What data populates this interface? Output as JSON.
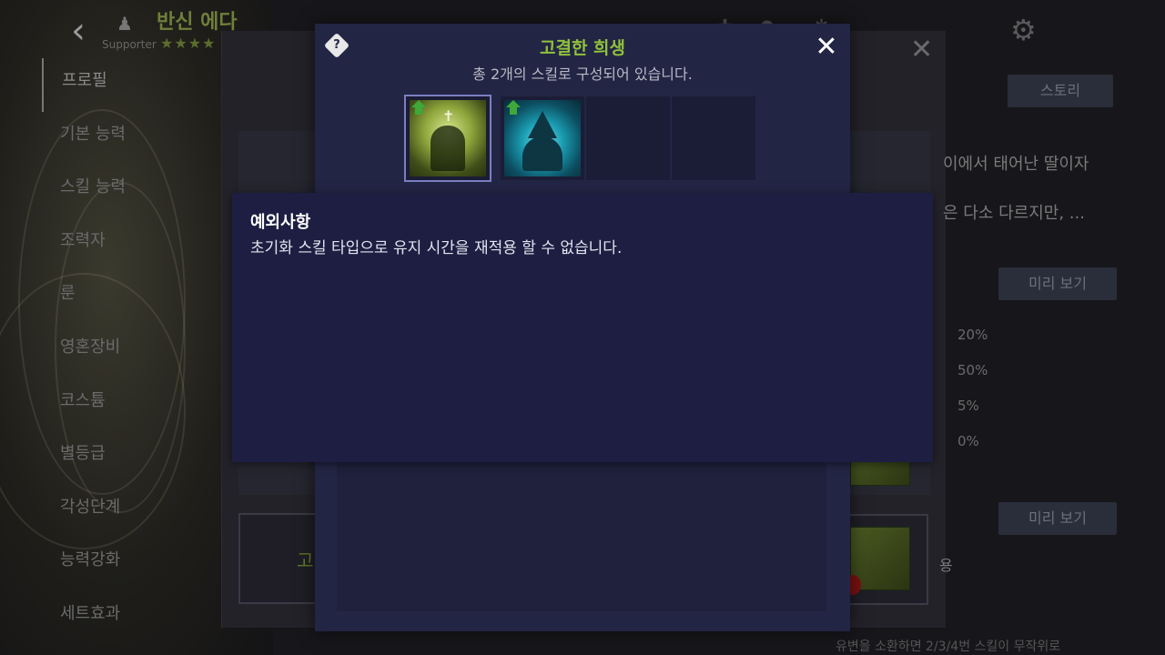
{
  "header": {
    "character_name": "반신 에다",
    "role_label": "Supporter",
    "stars": "★★★★"
  },
  "menu": {
    "items": [
      "프로필",
      "기본 능력",
      "스킬 능력",
      "조력자",
      "룬",
      "영혼장비",
      "코스튬",
      "별등급",
      "각성단계",
      "능력강화",
      "세트효과"
    ]
  },
  "background": {
    "story_button": "스토리",
    "story_line1": "이에서 태어난 딸이자",
    "story_line2": "은 다소 다르지만, ...",
    "preview_button_1": "미리 보기",
    "preview_button_2": "미리 보기",
    "stats": [
      "20%",
      "50%",
      "5%",
      "0%"
    ],
    "card_text": "고",
    "card_side_text": "용",
    "bottom_text": "유변을 소환하면 2/3/4번 스킬이 무작위로"
  },
  "dialog": {
    "title": "고결한 희생",
    "subtitle": "총 2개의 스킬로 구성되어 있습니다.",
    "help_label": "?",
    "close_label": "✕"
  },
  "tooltip": {
    "title": "예외사항",
    "text": "초기화 스킬 타입으로 유지 시간을 재적용 할 수 없습니다."
  },
  "colors": {
    "accent_green": "#8fc23b",
    "dialog_bg": "#232545",
    "tooltip_bg": "#1d1e42"
  }
}
